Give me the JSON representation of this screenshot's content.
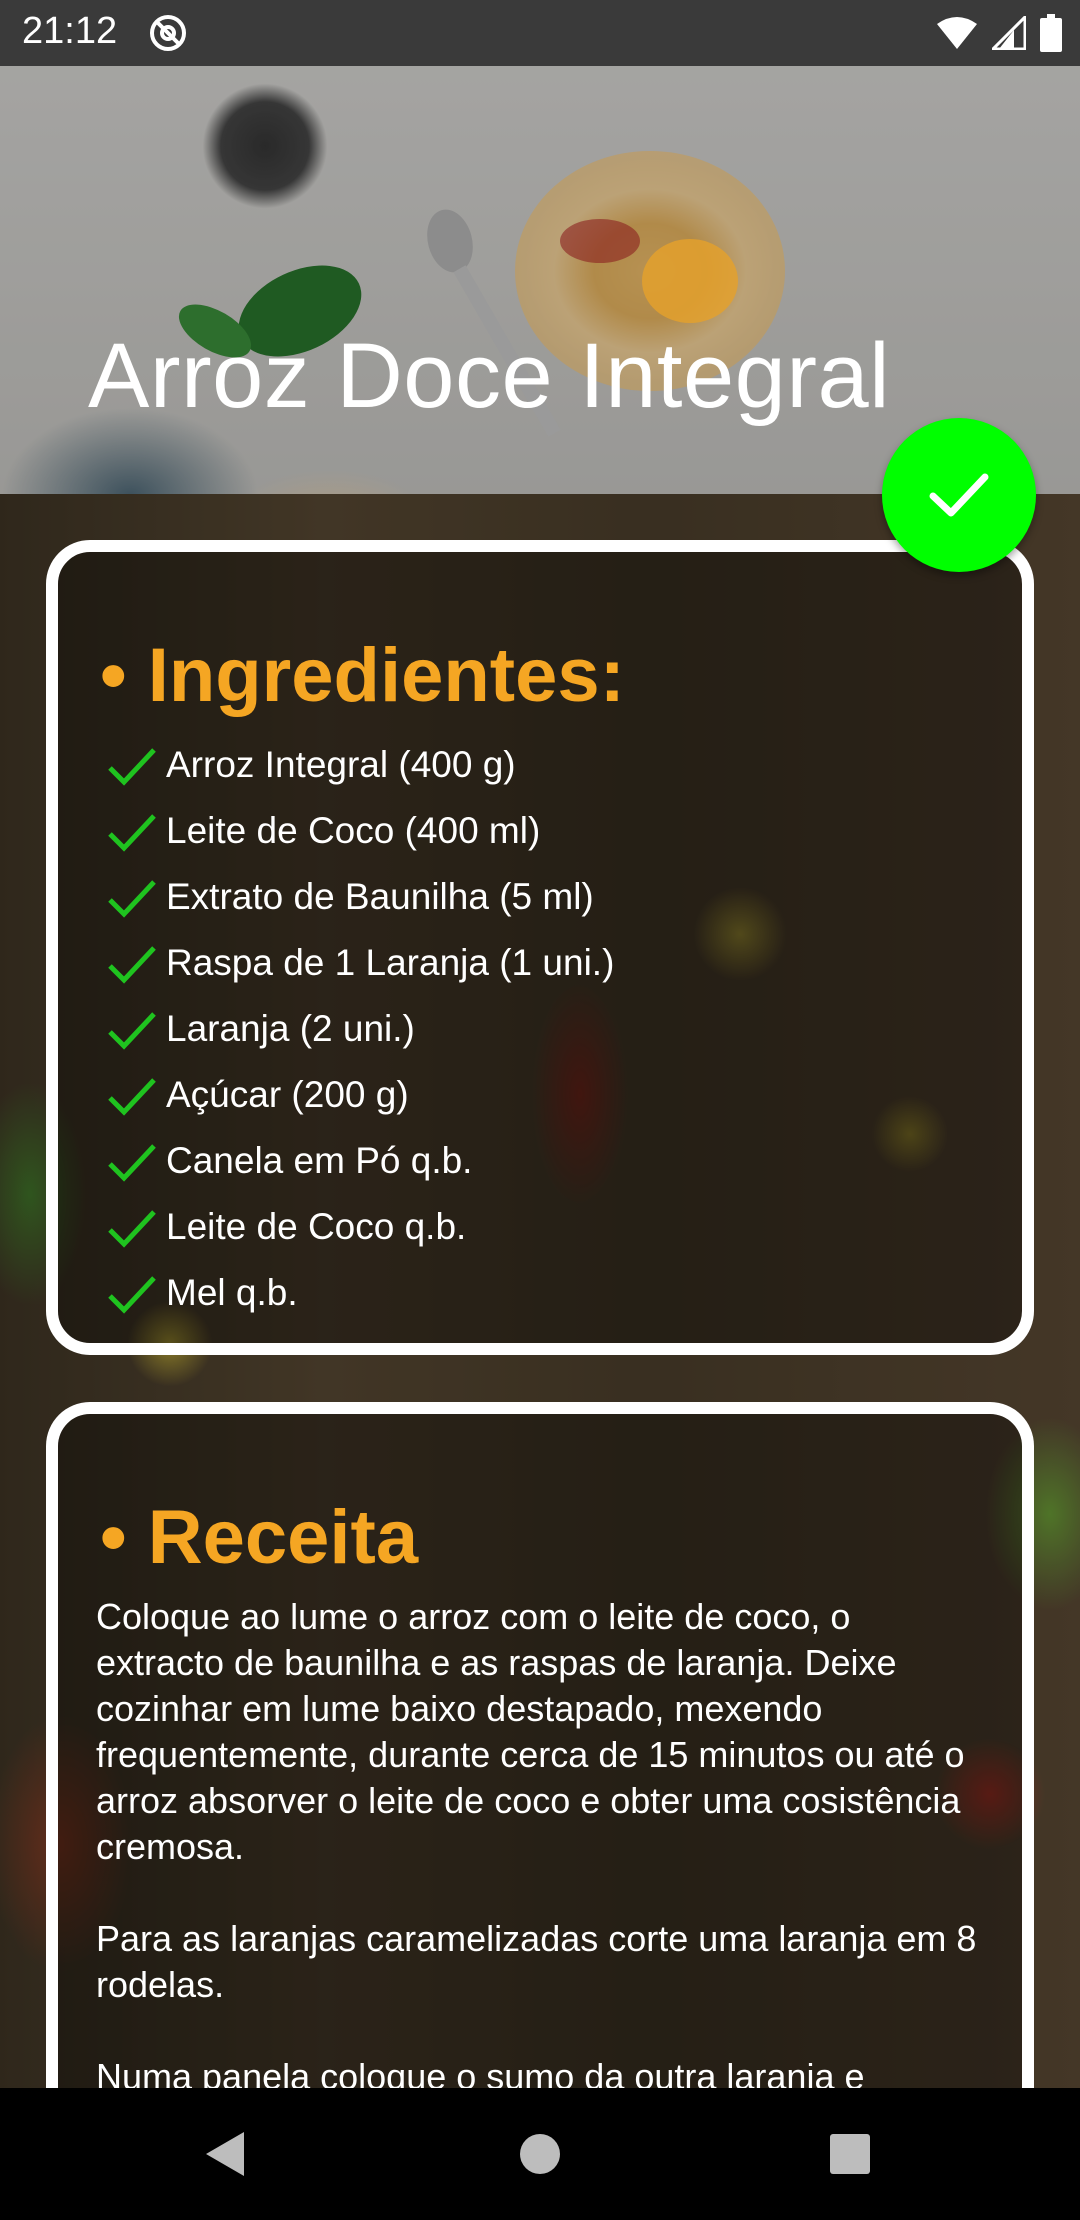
{
  "status_bar": {
    "time": "21:12",
    "app_icon": "at-sign-icon",
    "icons": [
      "wifi-icon",
      "signal-icon",
      "battery-icon"
    ]
  },
  "header": {
    "title": "Arroz Doce Integral"
  },
  "done_button": {
    "icon": "check-icon",
    "color": "#00ff00"
  },
  "ingredients": {
    "heading": "• Ingredientes:",
    "check_color": "#1fc31f",
    "items": [
      "Arroz Integral (400 g)",
      "Leite de Coco (400 ml)",
      "Extrato de Baunilha (5 ml)",
      "Raspa de 1 Laranja (1 uni.)",
      "Laranja (2 uni.)",
      "Açúcar (200 g)",
      "Canela em Pó q.b.",
      "Leite de Coco q.b.",
      "Mel q.b."
    ]
  },
  "recipe": {
    "heading": "• Receita",
    "paragraphs": [
      "Coloque ao lume o arroz com o leite de coco, o extracto de baunilha e as raspas de laranja. Deixe cozinhar em lume baixo destapado, mexendo frequentemente, durante cerca de 15 minutos ou até o arroz absorver o leite de coco e obter uma cosistência cremosa.",
      "Para as laranjas caramelizadas corte uma laranja em 8 rodelas.",
      "Numa panela coloque o sumo da outra laranja e"
    ]
  },
  "colors": {
    "heading": "#f5a623",
    "card_border": "#ffffff"
  },
  "nav_bar": {
    "icons": [
      "back-icon",
      "home-icon",
      "recents-icon"
    ]
  }
}
